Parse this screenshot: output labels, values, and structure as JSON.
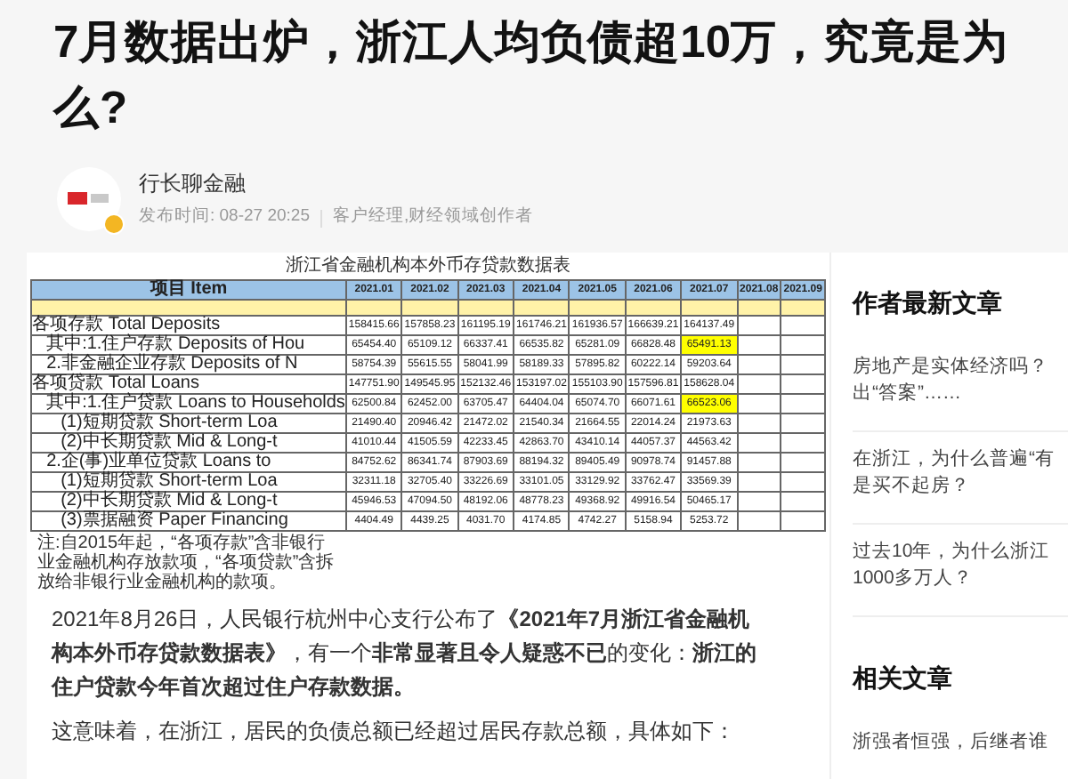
{
  "article": {
    "title_lines": [
      "7月数据出炉，浙江人均负债超10万，究竟是为",
      "么?"
    ],
    "author": {
      "name": "行长聊金融",
      "published": "发布时间: 08-27  20:25",
      "role": "客户经理,财经领域创作者"
    },
    "figure": {
      "title": "浙江省金融机构本外币存贷款数据表",
      "columns": [
        "项目 Item",
        "2021.01",
        "2021.02",
        "2021.03",
        "2021.04",
        "2021.05",
        "2021.06",
        "2021.07",
        "2021.08",
        "2021.09"
      ],
      "rows": [
        {
          "label": "各项存款 Total Deposits",
          "values": [
            {
              "text": "158415.66",
              "highlighted": false
            },
            {
              "text": "157858.23",
              "highlighted": false
            },
            {
              "text": "161195.19",
              "highlighted": false
            },
            {
              "text": "161746.21",
              "highlighted": false
            },
            {
              "text": "161936.57",
              "highlighted": false
            },
            {
              "text": "166639.21",
              "highlighted": false
            },
            {
              "text": "164137.49",
              "highlighted": false
            }
          ],
          "children": [
            {
              "label": "其中:1.住户存款 Deposits of Hou",
              "values": [
                {
                  "text": "65454.40",
                  "highlighted": false
                },
                {
                  "text": "65109.12",
                  "highlighted": false
                },
                {
                  "text": "66337.41",
                  "highlighted": false
                },
                {
                  "text": "66535.82",
                  "highlighted": false
                },
                {
                  "text": "65281.09",
                  "highlighted": false
                },
                {
                  "text": "66828.48",
                  "highlighted": false
                },
                {
                  "text": "65491.13",
                  "highlighted": true
                }
              ]
            },
            {
              "label": "2.非金融企业存款 Deposits of N",
              "values": [
                {
                  "text": "58754.39",
                  "highlighted": false
                },
                {
                  "text": "55615.55",
                  "highlighted": false
                },
                {
                  "text": "58041.99",
                  "highlighted": false
                },
                {
                  "text": "58189.33",
                  "highlighted": false
                },
                {
                  "text": "57895.82",
                  "highlighted": false
                },
                {
                  "text": "60222.14",
                  "highlighted": false
                },
                {
                  "text": "59203.64",
                  "highlighted": false
                }
              ]
            }
          ]
        },
        {
          "label": "各项贷款 Total Loans",
          "values": [
            {
              "text": "147751.90",
              "highlighted": false
            },
            {
              "text": "149545.95",
              "highlighted": false
            },
            {
              "text": "152132.46",
              "highlighted": false
            },
            {
              "text": "153197.02",
              "highlighted": false
            },
            {
              "text": "155103.90",
              "highlighted": false
            },
            {
              "text": "157596.81",
              "highlighted": false
            },
            {
              "text": "158628.04",
              "highlighted": false
            }
          ],
          "children": [
            {
              "label": "其中:1.住户贷款 Loans to Households",
              "values": [
                {
                  "text": "62500.84",
                  "highlighted": false
                },
                {
                  "text": "62452.00",
                  "highlighted": false
                },
                {
                  "text": "63705.47",
                  "highlighted": false
                },
                {
                  "text": "64404.04",
                  "highlighted": false
                },
                {
                  "text": "65074.70",
                  "highlighted": false
                },
                {
                  "text": "66071.61",
                  "highlighted": false
                },
                {
                  "text": "66523.06",
                  "highlighted": true
                }
              ],
              "children": [
                {
                  "label": "(1)短期贷款 Short-term Loa",
                  "values": [
                    {
                      "text": "21490.40",
                      "highlighted": false
                    },
                    {
                      "text": "20946.42",
                      "highlighted": false
                    },
                    {
                      "text": "21472.02",
                      "highlighted": false
                    },
                    {
                      "text": "21540.34",
                      "highlighted": false
                    },
                    {
                      "text": "21664.55",
                      "highlighted": false
                    },
                    {
                      "text": "22014.24",
                      "highlighted": false
                    },
                    {
                      "text": "21973.63",
                      "highlighted": false
                    }
                  ]
                },
                {
                  "label": "(2)中长期贷款 Mid & Long-t",
                  "values": [
                    {
                      "text": "41010.44",
                      "highlighted": false
                    },
                    {
                      "text": "41505.59",
                      "highlighted": false
                    },
                    {
                      "text": "42233.45",
                      "highlighted": false
                    },
                    {
                      "text": "42863.70",
                      "highlighted": false
                    },
                    {
                      "text": "43410.14",
                      "highlighted": false
                    },
                    {
                      "text": "44057.37",
                      "highlighted": false
                    },
                    {
                      "text": "44563.42",
                      "highlighted": false
                    }
                  ]
                }
              ]
            },
            {
              "label": "2.企(事)业单位贷款 Loans to",
              "values": [
                {
                  "text": "84752.62",
                  "highlighted": false
                },
                {
                  "text": "86341.74",
                  "highlighted": false
                },
                {
                  "text": "87903.69",
                  "highlighted": false
                },
                {
                  "text": "88194.32",
                  "highlighted": false
                },
                {
                  "text": "89405.49",
                  "highlighted": false
                },
                {
                  "text": "90978.74",
                  "highlighted": false
                },
                {
                  "text": "91457.88",
                  "highlighted": false
                }
              ],
              "children": [
                {
                  "label": "(1)短期贷款 Short-term Loa",
                  "values": [
                    {
                      "text": "32311.18",
                      "highlighted": false
                    },
                    {
                      "text": "32705.40",
                      "highlighted": false
                    },
                    {
                      "text": "33226.69",
                      "highlighted": false
                    },
                    {
                      "text": "33101.05",
                      "highlighted": false
                    },
                    {
                      "text": "33129.92",
                      "highlighted": false
                    },
                    {
                      "text": "33762.47",
                      "highlighted": false
                    },
                    {
                      "text": "33569.39",
                      "highlighted": false
                    }
                  ]
                },
                {
                  "label": "(2)中长期贷款 Mid & Long-t",
                  "values": [
                    {
                      "text": "45946.53",
                      "highlighted": false
                    },
                    {
                      "text": "47094.50",
                      "highlighted": false
                    },
                    {
                      "text": "48192.06",
                      "highlighted": false
                    },
                    {
                      "text": "48778.23",
                      "highlighted": false
                    },
                    {
                      "text": "49368.92",
                      "highlighted": false
                    },
                    {
                      "text": "49916.54",
                      "highlighted": false
                    },
                    {
                      "text": "50465.17",
                      "highlighted": false
                    }
                  ]
                },
                {
                  "label": "(3)票据融资 Paper Financing",
                  "values": [
                    {
                      "text": "4404.49",
                      "highlighted": false
                    },
                    {
                      "text": "4439.25",
                      "highlighted": false
                    },
                    {
                      "text": "4031.70",
                      "highlighted": false
                    },
                    {
                      "text": "4174.85",
                      "highlighted": false
                    },
                    {
                      "text": "4742.27",
                      "highlighted": false
                    },
                    {
                      "text": "5158.94",
                      "highlighted": false
                    },
                    {
                      "text": "5253.72",
                      "highlighted": false
                    }
                  ]
                }
              ]
            }
          ]
        }
      ],
      "note": "注:自2015年起，“各项存款”含非银行业金融机构存放款项，“各项贷款”含拆放给非银行业金融机构的款项。"
    },
    "paragraphs": [
      "2021年8月26日，人民银行杭州中心支行公布了**《2021年7月浙江省金融机构本外币存贷款数据表》**，有一个**非常显著且令人疑惑不已**的变化：**浙江的住户贷款今年首次超过住户存款数据。**",
      "这意味着，在浙江，居民的负债总额已经超过居民存款总额，具体如下："
    ]
  },
  "sidebar": {
    "sections": [
      {
        "heading": "作者最新文章",
        "items": [
          {
            "lines": [
              "房地产是实体经济吗？",
              "出“答案”……"
            ]
          },
          {
            "lines": [
              "在浙江，为什么普遍“有",
              "是买不起房？"
            ]
          },
          {
            "lines": [
              "过去10年，为什么浙江",
              "1000多万人？"
            ]
          }
        ]
      },
      {
        "heading": "相关文章",
        "items": [
          {
            "lines": [
              "浙强者恒强，后继者谁"
            ]
          }
        ]
      }
    ]
  }
}
